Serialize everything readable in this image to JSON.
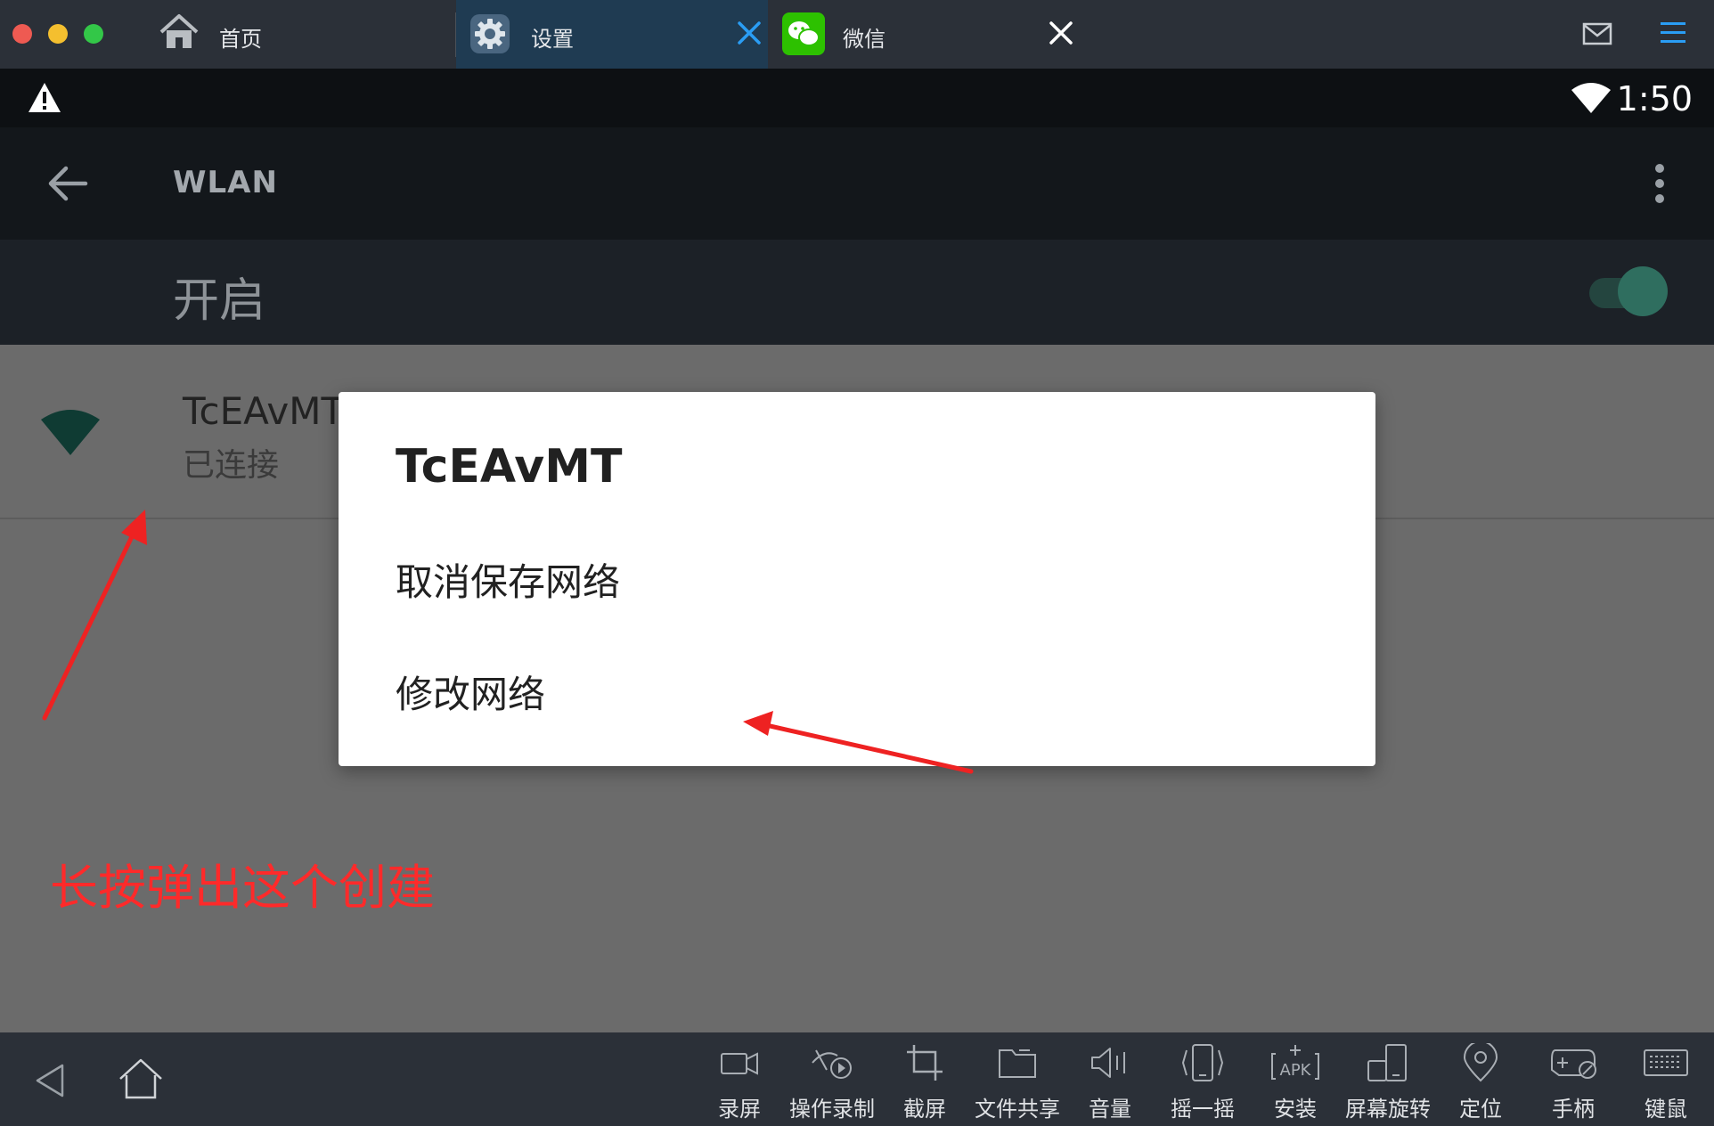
{
  "tabs": [
    {
      "label": "首页",
      "active": false
    },
    {
      "label": "设置",
      "active": true
    },
    {
      "label": "微信",
      "active": false
    }
  ],
  "status_bar": {
    "time": "1:50"
  },
  "app_bar": {
    "title": "WLAN"
  },
  "wifi_toggle": {
    "label": "开启",
    "on": true
  },
  "network": {
    "name": "TcEAvMT",
    "status": "已连接"
  },
  "dialog": {
    "title": "TcEAvMT",
    "items": [
      "取消保存网络",
      "修改网络"
    ]
  },
  "annotation": {
    "text": "长按弹出这个创建",
    "color": "#ff2a2a"
  },
  "toolbar": {
    "items": [
      {
        "label": "录屏",
        "icon": "video-camera-icon"
      },
      {
        "label": "操作录制",
        "icon": "record-macro-icon"
      },
      {
        "label": "截屏",
        "icon": "crop-icon"
      },
      {
        "label": "文件共享",
        "icon": "folder-icon"
      },
      {
        "label": "音量",
        "icon": "volume-icon"
      },
      {
        "label": "摇一摇",
        "icon": "shake-phone-icon"
      },
      {
        "label": "安装",
        "icon": "apk-install-icon"
      },
      {
        "label": "屏幕旋转",
        "icon": "rotate-screen-icon"
      },
      {
        "label": "定位",
        "icon": "location-pin-icon"
      },
      {
        "label": "手柄",
        "icon": "gamepad-icon"
      },
      {
        "label": "键鼠",
        "icon": "keyboard-icon"
      }
    ]
  },
  "colors": {
    "tab_active": "#1f3b52",
    "accent_blue": "#2a9df4",
    "toggle_on": "#2f6e5f",
    "dialog_bg": "#ffffff",
    "annotation_red": "#ff2a2a"
  }
}
